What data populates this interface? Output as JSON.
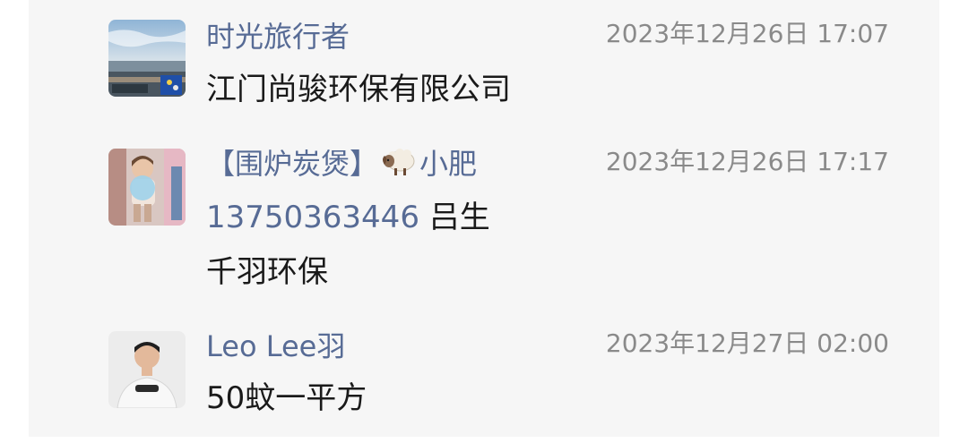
{
  "comments": [
    {
      "author": "时光旅行者",
      "time": "2023年12月26日 17:07",
      "lines": [
        "江门尚骏环保有限公司"
      ],
      "avatar_icon": "seaside-photo-avatar"
    },
    {
      "author_prefix": "【围炉炭煲】",
      "author_emoji": "sheep-emoji",
      "author_suffix": "小肥",
      "time": "2023年12月26日 17:17",
      "phone": "13750363446",
      "phone_suffix": " 吕生",
      "lines": [
        "千羽环保"
      ],
      "avatar_icon": "child-photo-avatar"
    },
    {
      "author": "Leo Lee羽",
      "time": "2023年12月27日 02:00",
      "lines": [
        "50蚊一平方"
      ],
      "avatar_icon": "man-portrait-avatar"
    }
  ],
  "colors": {
    "panel_bg": "#f6f6f6",
    "author_link": "#576b95",
    "timestamp": "#8a8a8a",
    "text": "#1a1a1a"
  }
}
